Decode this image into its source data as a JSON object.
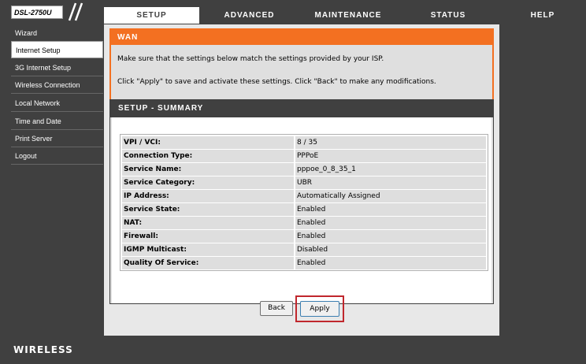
{
  "header": {
    "model": "DSL-2750U",
    "tabs": [
      {
        "label": "SETUP",
        "active": true
      },
      {
        "label": "ADVANCED",
        "active": false
      },
      {
        "label": "MAINTENANCE",
        "active": false
      },
      {
        "label": "STATUS",
        "active": false
      },
      {
        "label": "HELP",
        "active": false
      }
    ]
  },
  "sidebar": {
    "items": [
      {
        "label": "Wizard",
        "selected": false
      },
      {
        "label": "Internet Setup",
        "selected": true
      },
      {
        "label": "3G Internet Setup",
        "selected": false
      },
      {
        "label": "Wireless Connection",
        "selected": false
      },
      {
        "label": "Local Network",
        "selected": false
      },
      {
        "label": "Time and Date",
        "selected": false
      },
      {
        "label": "Print Server",
        "selected": false
      },
      {
        "label": "Logout",
        "selected": false
      }
    ]
  },
  "wan": {
    "title": "WAN",
    "line1": "Make sure that the settings below match the settings provided by your ISP.",
    "line2": "Click \"Apply\" to save and activate these settings. Click \"Back\" to make any modifications."
  },
  "summary": {
    "title": "SETUP - SUMMARY",
    "rows": [
      {
        "label": "VPI / VCI:",
        "value": "8 / 35"
      },
      {
        "label": "Connection Type:",
        "value": "PPPoE"
      },
      {
        "label": "Service Name:",
        "value": "pppoe_0_8_35_1"
      },
      {
        "label": "Service Category:",
        "value": "UBR"
      },
      {
        "label": "IP Address:",
        "value": "Automatically Assigned"
      },
      {
        "label": "Service State:",
        "value": "Enabled"
      },
      {
        "label": "NAT:",
        "value": "Enabled"
      },
      {
        "label": "Firewall:",
        "value": "Enabled"
      },
      {
        "label": "IGMP Multicast:",
        "value": "Disabled"
      },
      {
        "label": "Quality Of Service:",
        "value": "Enabled"
      }
    ]
  },
  "buttons": {
    "back": "Back",
    "apply": "Apply"
  },
  "footer": {
    "brand": "WIRELESS"
  },
  "colors": {
    "accent": "#f37021",
    "dark": "#404040",
    "highlight": "#c0272d"
  }
}
